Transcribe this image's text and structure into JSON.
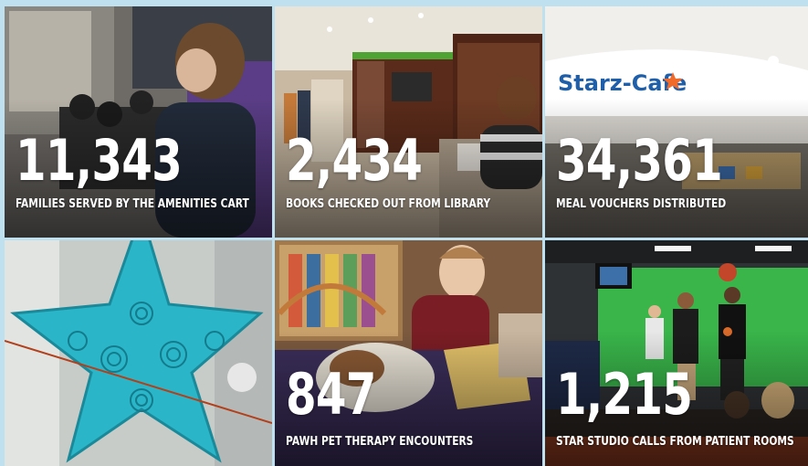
{
  "tiles": [
    {
      "number": "11,343",
      "caption": "FAMILIES SERVED BY THE AMENITIES CART"
    },
    {
      "number": "2,434",
      "caption": "BOOKS CHECKED OUT FROM LIBRARY"
    },
    {
      "number": "34,361",
      "caption": "MEAL VOUCHERS DISTRIBUTED"
    },
    {
      "number": "",
      "caption": ""
    },
    {
      "number": "847",
      "caption": "PAWH PET THERAPY ENCOUNTERS"
    },
    {
      "number": "1,215",
      "caption": "STAR STUDIO CALLS FROM PATIENT ROOMS"
    }
  ],
  "cafe_sign": "Starz-Cafe",
  "colors": {
    "accent": "#2ab6c8",
    "cafe_blue": "#1f5ea8",
    "green_screen": "#39b54a"
  }
}
